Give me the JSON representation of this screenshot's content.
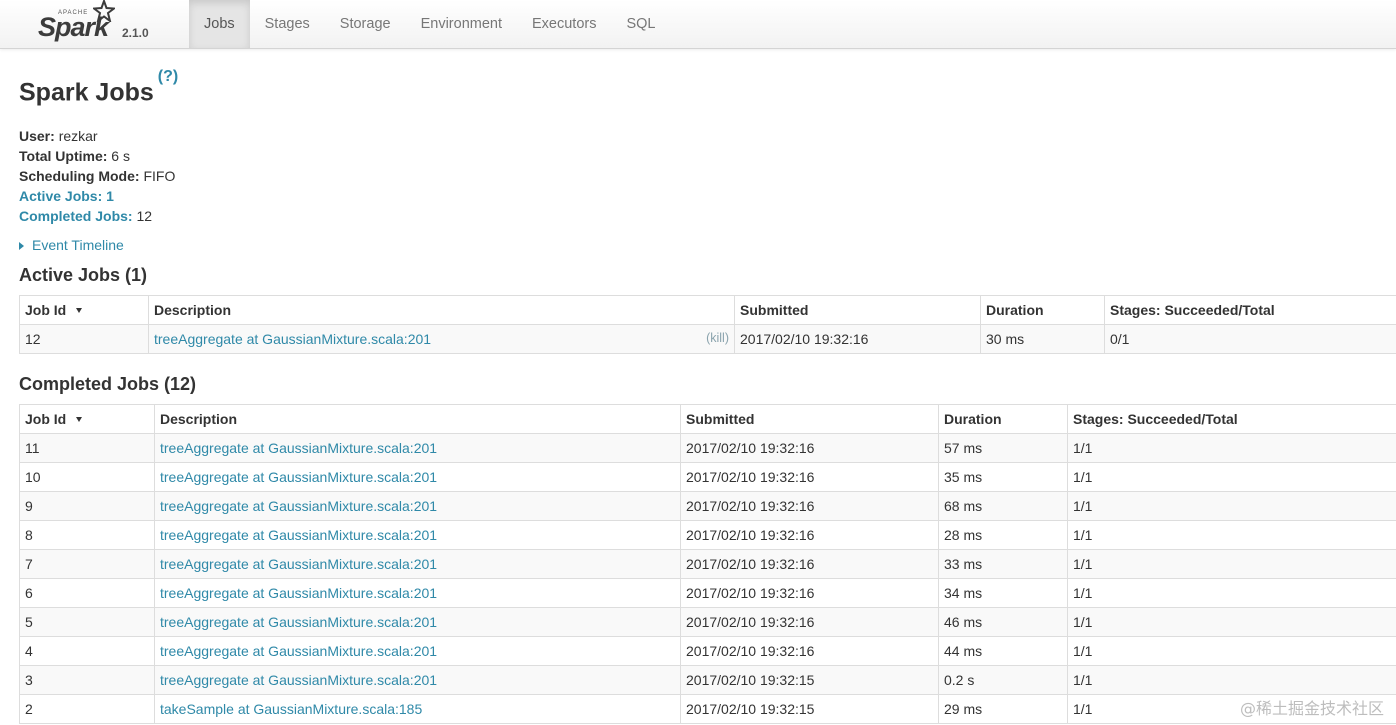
{
  "brand": {
    "apache": "APACHE",
    "name": "Spark",
    "version": "2.1.0"
  },
  "nav": {
    "tabs": [
      {
        "label": "Jobs",
        "active": true
      },
      {
        "label": "Stages",
        "active": false
      },
      {
        "label": "Storage",
        "active": false
      },
      {
        "label": "Environment",
        "active": false
      },
      {
        "label": "Executors",
        "active": false
      },
      {
        "label": "SQL",
        "active": false
      }
    ]
  },
  "page": {
    "title": "Spark Jobs",
    "help": "(?)",
    "summary": {
      "user_label": "User:",
      "user": "rezkar",
      "uptime_label": "Total Uptime:",
      "uptime": "6 s",
      "mode_label": "Scheduling Mode:",
      "mode": "FIFO",
      "active_label": "Active Jobs:",
      "active": "1",
      "completed_label": "Completed Jobs:",
      "completed": "12"
    },
    "event_timeline": "Event Timeline"
  },
  "active_jobs": {
    "heading": "Active Jobs (1)",
    "columns": [
      "Job Id",
      "Description",
      "Submitted",
      "Duration",
      "Stages: Succeeded/Total"
    ],
    "kill_label": "(kill)",
    "rows": [
      {
        "id": "12",
        "description": "treeAggregate at GaussianMixture.scala:201",
        "submitted": "2017/02/10 19:32:16",
        "duration": "30 ms",
        "stages": "0/1"
      }
    ]
  },
  "completed_jobs": {
    "heading": "Completed Jobs (12)",
    "columns": [
      "Job Id",
      "Description",
      "Submitted",
      "Duration",
      "Stages: Succeeded/Total"
    ],
    "rows": [
      {
        "id": "11",
        "description": "treeAggregate at GaussianMixture.scala:201",
        "submitted": "2017/02/10 19:32:16",
        "duration": "57 ms",
        "stages": "1/1"
      },
      {
        "id": "10",
        "description": "treeAggregate at GaussianMixture.scala:201",
        "submitted": "2017/02/10 19:32:16",
        "duration": "35 ms",
        "stages": "1/1"
      },
      {
        "id": "9",
        "description": "treeAggregate at GaussianMixture.scala:201",
        "submitted": "2017/02/10 19:32:16",
        "duration": "68 ms",
        "stages": "1/1"
      },
      {
        "id": "8",
        "description": "treeAggregate at GaussianMixture.scala:201",
        "submitted": "2017/02/10 19:32:16",
        "duration": "28 ms",
        "stages": "1/1"
      },
      {
        "id": "7",
        "description": "treeAggregate at GaussianMixture.scala:201",
        "submitted": "2017/02/10 19:32:16",
        "duration": "33 ms",
        "stages": "1/1"
      },
      {
        "id": "6",
        "description": "treeAggregate at GaussianMixture.scala:201",
        "submitted": "2017/02/10 19:32:16",
        "duration": "34 ms",
        "stages": "1/1"
      },
      {
        "id": "5",
        "description": "treeAggregate at GaussianMixture.scala:201",
        "submitted": "2017/02/10 19:32:16",
        "duration": "46 ms",
        "stages": "1/1"
      },
      {
        "id": "4",
        "description": "treeAggregate at GaussianMixture.scala:201",
        "submitted": "2017/02/10 19:32:16",
        "duration": "44 ms",
        "stages": "1/1"
      },
      {
        "id": "3",
        "description": "treeAggregate at GaussianMixture.scala:201",
        "submitted": "2017/02/10 19:32:15",
        "duration": "0.2 s",
        "stages": "1/1"
      },
      {
        "id": "2",
        "description": "takeSample at GaussianMixture.scala:185",
        "submitted": "2017/02/10 19:32:15",
        "duration": "29 ms",
        "stages": "1/1"
      }
    ]
  },
  "watermark": "@稀土掘金技术社区",
  "colors": {
    "link": "#2f89a8",
    "nav_active_bg": "#e5e5e5",
    "row_stripe": "#f9f9f9",
    "border": "#dddddd"
  },
  "icons": {
    "help": "question-mark",
    "timeline_toggle": "triangle-right",
    "sort": "triangle-down",
    "logo": "spark-star"
  }
}
